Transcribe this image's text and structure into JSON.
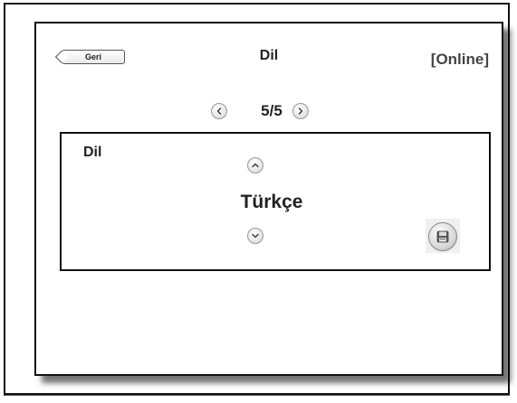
{
  "header": {
    "back_label": "Geri",
    "title": "Dil",
    "status": "[Online]"
  },
  "pager": {
    "current": "5/5",
    "prev_icon": "chevron-left-icon",
    "next_icon": "chevron-right-icon"
  },
  "setting": {
    "label": "Dil",
    "value": "Türkçe",
    "up_icon": "chevron-up-icon",
    "down_icon": "chevron-down-icon",
    "save_icon": "floppy-disk-icon"
  }
}
